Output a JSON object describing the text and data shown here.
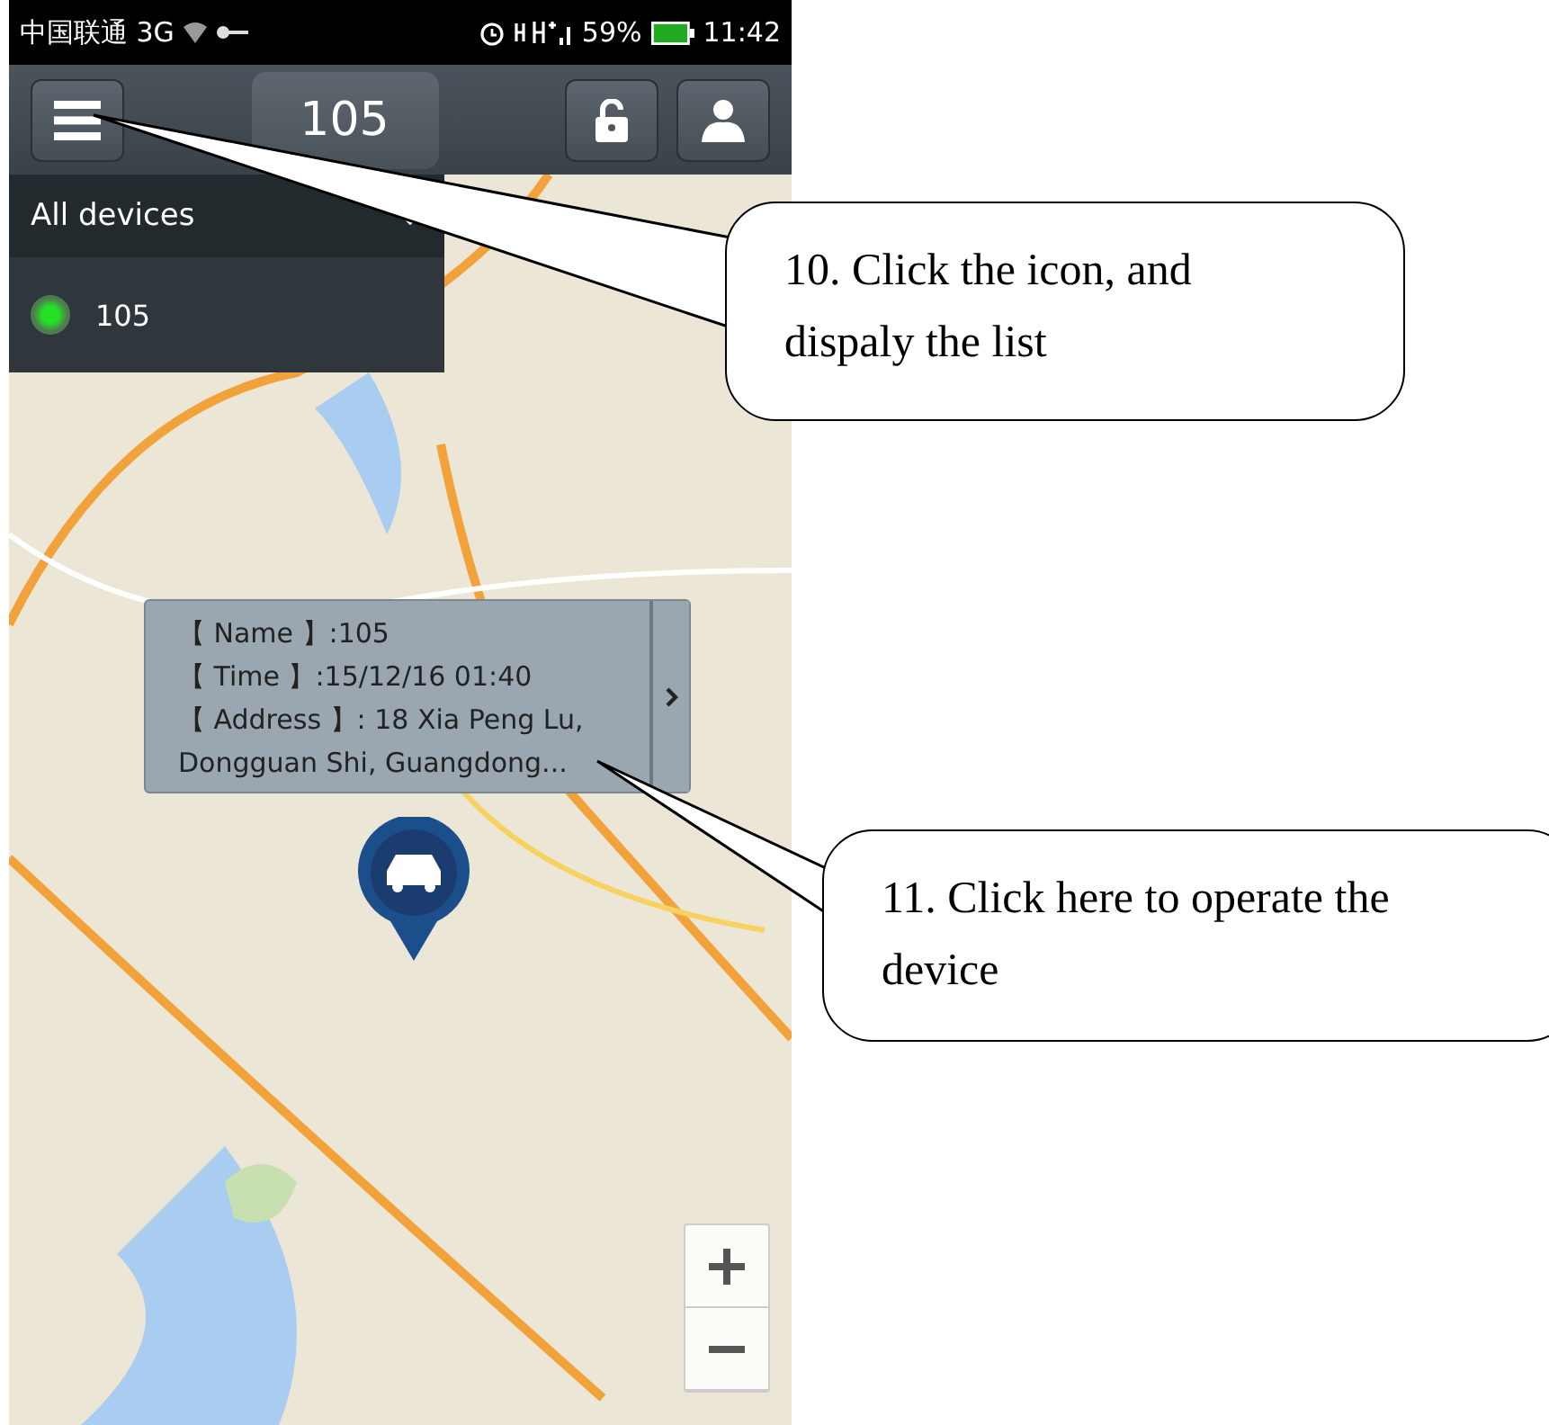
{
  "status_bar": {
    "carrier": "中国联通 3G",
    "battery": "59%",
    "time": "11:42"
  },
  "toolbar": {
    "title": "105"
  },
  "device_list": {
    "filter": "All devices",
    "expanded": true,
    "devices": [
      {
        "name": "105",
        "online": true
      }
    ]
  },
  "popup": {
    "lines": [
      "【 Name 】:105",
      "【 Time 】:15/12/16 01:40",
      "【 Address 】: 18 Xia Peng Lu, Dongguan Shi, Guangdong..."
    ]
  },
  "callouts": [
    {
      "text": "10. Click the icon, and dispaly the list"
    },
    {
      "text": "11. Click here to operate the device"
    }
  ]
}
